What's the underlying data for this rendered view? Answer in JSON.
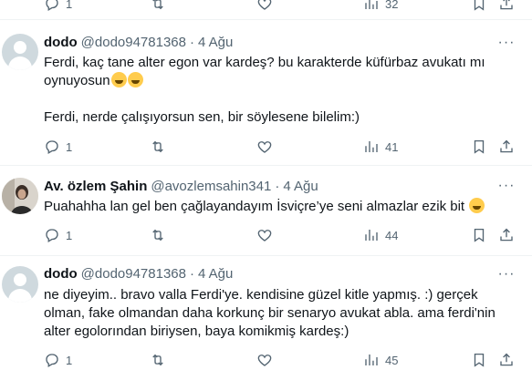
{
  "top_actions": {
    "replies": "1",
    "views": "32"
  },
  "tweets": [
    {
      "name": "dodo",
      "handle": "@dodo94781368",
      "separator": "·",
      "date": "4 Ağu",
      "text": "Ferdi, kaç tane alter egon var kardeş? bu karakterde küfürbaz avukatı mı oynuyosun",
      "emoji_text": "🤣🤣",
      "text2": "Ferdi, nerde çalışıyorsun sen, bir söylesene bilelim:)",
      "replies": "1",
      "views": "41"
    },
    {
      "name": "Av. özlem Şahin",
      "handle": "@avozlemsahin341",
      "separator": "·",
      "date": "4 Ağu",
      "text": "Puahahha lan gel ben çağlayandayım İsviçre’ye seni almazlar ezik bit",
      "emoji_text": "😂",
      "replies": "1",
      "views": "44"
    },
    {
      "name": "dodo",
      "handle": "@dodo94781368",
      "separator": "·",
      "date": "4 Ağu",
      "text": "ne diyeyim.. bravo valla Ferdi'ye. kendisine güzel kitle yapmış. :) gerçek olman, fake olmandan daha korkunç bir senaryo avukat abla. ama ferdi'nin alter egolorından biriysen, baya komikmiş kardeş:)",
      "replies": "1",
      "views": "45"
    }
  ],
  "more_glyph": "···",
  "colors": {
    "text": "#0f1419",
    "secondary": "#536471",
    "divider": "#eff3f4",
    "emoji": "#ffcc4d"
  }
}
